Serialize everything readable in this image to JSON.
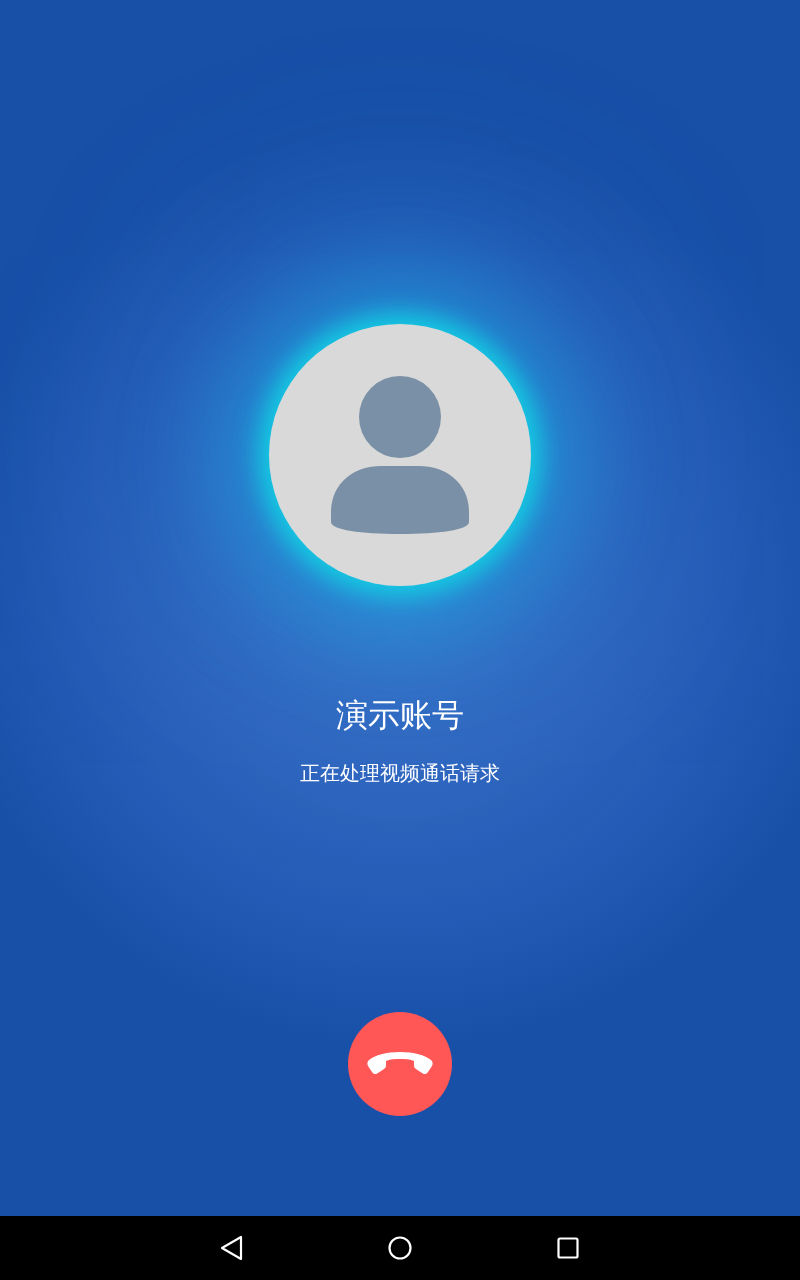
{
  "contact": {
    "name": "演示账号",
    "status": "正在处理视频通话请求"
  }
}
